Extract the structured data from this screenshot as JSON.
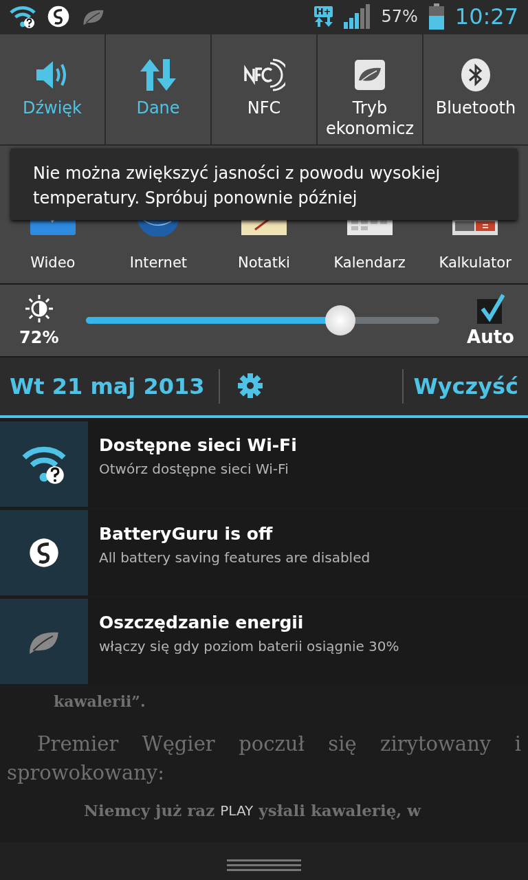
{
  "status_bar": {
    "battery_text": "57%",
    "time": "10:27",
    "network": "H+"
  },
  "quick_toggles": [
    {
      "label": "Dźwięk",
      "kind": "sound",
      "on": true
    },
    {
      "label": "Dane",
      "kind": "data",
      "on": true
    },
    {
      "label": "NFC",
      "kind": "nfc",
      "on": false
    },
    {
      "label": "Tryb ekonomicz",
      "kind": "eco",
      "on": false
    },
    {
      "label": "Bluetooth",
      "kind": "bluetooth",
      "on": false
    }
  ],
  "toast": "Nie można zwiększyć jasności z powodu wysokiej temperatury. Spróbuj ponownie później",
  "apps": [
    {
      "label": "Wideo",
      "kind": "video"
    },
    {
      "label": "Internet",
      "kind": "globe"
    },
    {
      "label": "Notatki",
      "kind": "notes"
    },
    {
      "label": "Kalendarz",
      "kind": "calendar"
    },
    {
      "label": "Kalkulator",
      "kind": "calculator"
    }
  ],
  "brightness": {
    "reading": "72%",
    "level": 0.72,
    "auto_label": "Auto",
    "auto_checked": true
  },
  "date_bar": {
    "date": "Wt 21 maj 2013",
    "clear_label": "Wyczyść"
  },
  "notifications": [
    {
      "kind": "wifi",
      "title": "Dostępne sieci Wi-Fi",
      "text": "Otwórz dostępne sieci Wi-Fi"
    },
    {
      "kind": "s",
      "title": "BatteryGuru is off",
      "text": "All battery saving features are disabled"
    },
    {
      "kind": "leaf",
      "title": "Oszczędzanie energii",
      "text": "włączy się gdy poziom baterii osiągnie 30%"
    }
  ],
  "article": {
    "line_1": "kawalerii”.",
    "paragraph": "Premier Węgier poczuł się zirytowany i sprowokowany:",
    "quote_start": "Niemcy już raz",
    "quote_end": "ysłali kawalerię, w",
    "overlay_label": "PLAY"
  }
}
